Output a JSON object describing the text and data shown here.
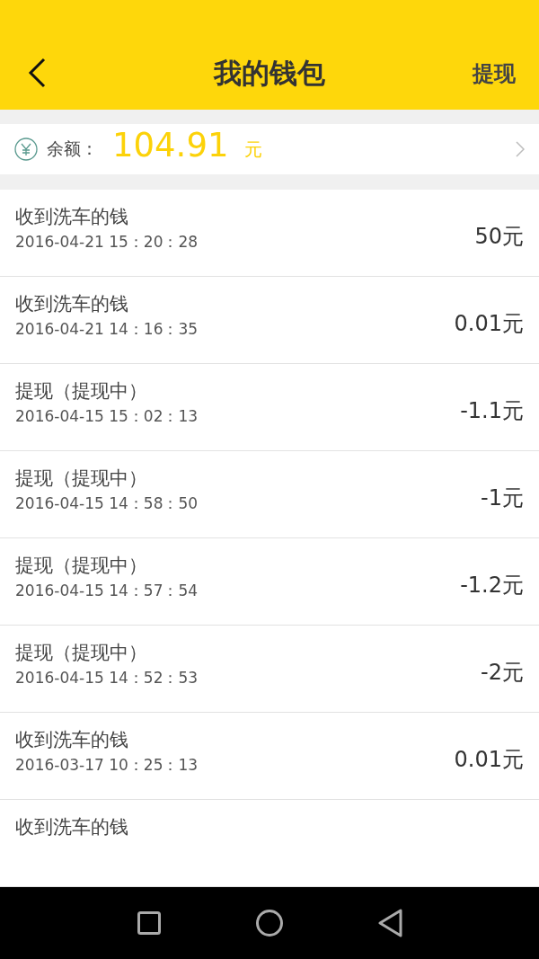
{
  "header": {
    "title": "我的钱包",
    "action": "提现"
  },
  "balance": {
    "label": "余额：",
    "amount": "104.91",
    "unit": "元"
  },
  "transactions": [
    {
      "title": "收到洗车的钱",
      "time": "2016-04-21 15：20：28",
      "amount": "50元"
    },
    {
      "title": "收到洗车的钱",
      "time": "2016-04-21 14：16：35",
      "amount": "0.01元"
    },
    {
      "title": "提现（提现中）",
      "time": "2016-04-15 15：02：13",
      "amount": "-1.1元"
    },
    {
      "title": "提现（提现中）",
      "time": "2016-04-15 14：58：50",
      "amount": "-1元"
    },
    {
      "title": "提现（提现中）",
      "time": "2016-04-15 14：57：54",
      "amount": "-1.2元"
    },
    {
      "title": "提现（提现中）",
      "time": "2016-04-15 14：52：53",
      "amount": "-2元"
    },
    {
      "title": "收到洗车的钱",
      "time": "2016-03-17 10：25：13",
      "amount": "0.01元"
    },
    {
      "title": "收到洗车的钱"
    }
  ]
}
